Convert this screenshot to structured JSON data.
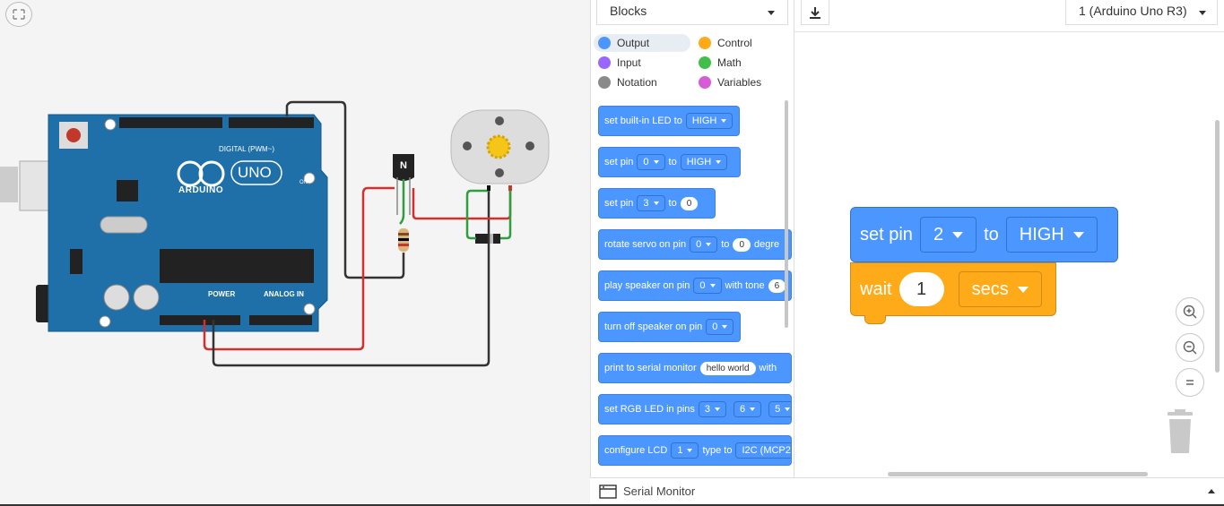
{
  "palette": {
    "dropdown_label": "Blocks",
    "categories": [
      {
        "label": "Output",
        "color": "#4c97ff"
      },
      {
        "label": "Control",
        "color": "#ffab19"
      },
      {
        "label": "Input",
        "color": "#9966ff"
      },
      {
        "label": "Math",
        "color": "#40bf4a"
      },
      {
        "label": "Notation",
        "color": "#8a8a8a"
      },
      {
        "label": "Variables",
        "color": "#d65cd6"
      }
    ],
    "blocks": {
      "b1": {
        "text": "set built-in LED to",
        "dd": "HIGH"
      },
      "b2": {
        "text": "set pin",
        "dd1": "0",
        "to": "to",
        "dd2": "HIGH"
      },
      "b3": {
        "text": "set pin",
        "dd1": "3",
        "to": "to",
        "pill": "0"
      },
      "b4": {
        "text": "rotate servo on pin",
        "dd1": "0",
        "to": "to",
        "pill": "0",
        "tail": "degre"
      },
      "b5": {
        "text": "play speaker on pin",
        "dd1": "0",
        "mid": "with tone",
        "pill": "6"
      },
      "b6": {
        "text": "turn off speaker on pin",
        "dd1": "0"
      },
      "b7": {
        "text": "print to serial monitor",
        "pill": "hello world",
        "tail": "with"
      },
      "b8": {
        "text": "set RGB LED in pins",
        "dd1": "3",
        "dd2": "6",
        "dd3": "5"
      },
      "b9": {
        "text": "configure LCD",
        "dd1": "1",
        "mid": "type to",
        "dd2": "I2C (MCP2"
      }
    }
  },
  "workspace": {
    "device_label": "1 (Arduino Uno R3)",
    "set_pin": {
      "label": "set pin",
      "pin": "2",
      "to": "to",
      "value": "HIGH"
    },
    "wait": {
      "label": "wait",
      "amount": "1",
      "unit": "secs"
    }
  },
  "serial_monitor": {
    "label": "Serial Monitor"
  },
  "board": {
    "brand": "ARDUINO",
    "model": "UNO",
    "digital_label": "DIGITAL (PWM~)",
    "power_label": "POWER",
    "analog_label": "ANALOG IN",
    "on_label": "ON",
    "transistor_label": "N"
  },
  "colors": {
    "output_block": "#4c97ff",
    "control_block": "#ffab19",
    "board_blue": "#1f6fa8"
  }
}
